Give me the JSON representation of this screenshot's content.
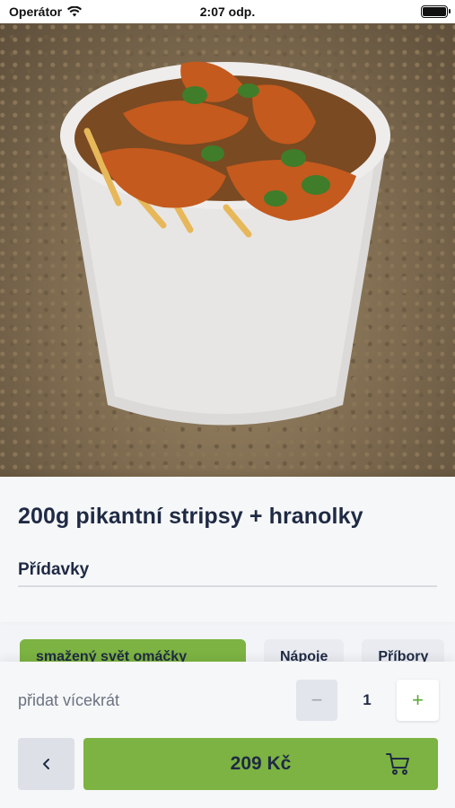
{
  "status_bar": {
    "carrier": "Operátor",
    "time": "2:07 odp."
  },
  "product": {
    "title": "200g pikantní stripsy + hranolky",
    "section_label": "Přídavky"
  },
  "chips": [
    {
      "label": "smažený svět omáčky",
      "active": true
    },
    {
      "label": "Nápoje",
      "active": false
    },
    {
      "label": "Příbory",
      "active": false
    }
  ],
  "quantity": {
    "label": "přidat vícekrát",
    "value": "1",
    "minus": "−",
    "plus": "+"
  },
  "actions": {
    "back_glyph": "<",
    "price": "209 Kč"
  },
  "colors": {
    "accent": "#7cb342",
    "text": "#1f2a44",
    "muted": "#6b7280"
  },
  "icons": [
    "wifi-icon",
    "battery-icon",
    "chevron-left-icon",
    "cart-icon"
  ]
}
